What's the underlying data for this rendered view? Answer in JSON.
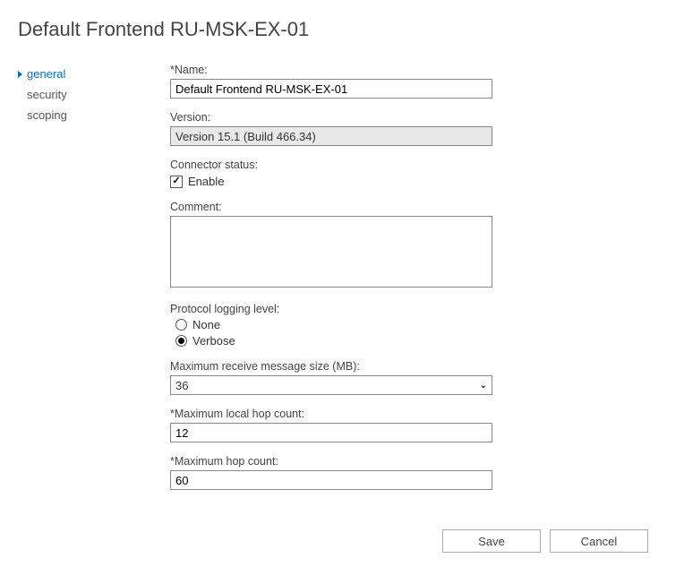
{
  "page_title": "Default Frontend RU-MSK-EX-01",
  "sidebar": {
    "items": [
      {
        "label": "general",
        "active": true
      },
      {
        "label": "security",
        "active": false
      },
      {
        "label": "scoping",
        "active": false
      }
    ]
  },
  "form": {
    "name": {
      "label": "*Name:",
      "value": "Default Frontend RU-MSK-EX-01"
    },
    "version": {
      "label": "Version:",
      "value": "Version 15.1 (Build 466.34)"
    },
    "connector_status": {
      "label": "Connector status:",
      "enable_label": "Enable",
      "enabled": true
    },
    "comment": {
      "label": "Comment:",
      "value": ""
    },
    "protocol_logging": {
      "label": "Protocol logging level:",
      "options": [
        {
          "label": "None",
          "selected": false
        },
        {
          "label": "Verbose",
          "selected": true
        }
      ]
    },
    "max_receive_size": {
      "label": "Maximum receive message size (MB):",
      "value": "36"
    },
    "max_local_hop": {
      "label": "*Maximum local hop count:",
      "value": "12"
    },
    "max_hop": {
      "label": "*Maximum hop count:",
      "value": "60"
    }
  },
  "buttons": {
    "save": "Save",
    "cancel": "Cancel"
  }
}
